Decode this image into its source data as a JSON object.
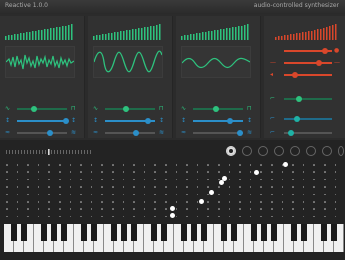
{
  "app": {
    "title": "Reactive 1.0.0",
    "subtitle": "audio-controlled synthesizer"
  },
  "colors": {
    "green": "#2ec27e",
    "teal": "#1fb2a6",
    "orange": "#d9472b",
    "blue": "#2b8fc9",
    "white": "#ffffff"
  },
  "modules": [
    {
      "name": "osc-1",
      "accent": "#2ec27e",
      "wave": "noise"
    },
    {
      "name": "osc-2",
      "accent": "#2ec27e",
      "wave": "sine-strong"
    },
    {
      "name": "osc-3",
      "accent": "#2ec27e",
      "wave": "sine-soft"
    },
    {
      "name": "effects",
      "accent": "#d9472b",
      "wave": "none"
    }
  ],
  "sequencer": {
    "selected_pattern": 1,
    "pattern_count": 8
  }
}
